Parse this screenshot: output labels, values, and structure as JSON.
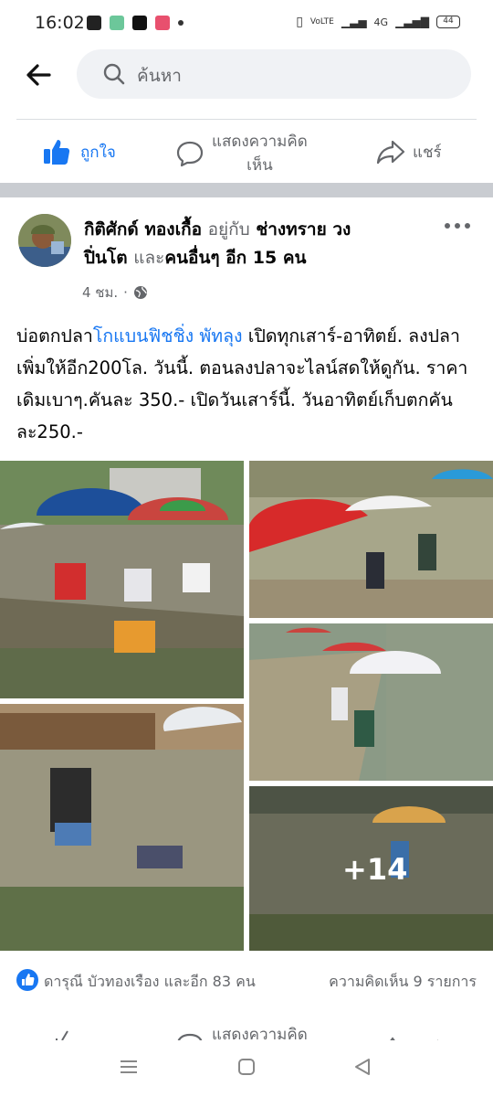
{
  "status": {
    "time": "16:02",
    "battery": "44",
    "net_labels": "VoLTE",
    "signal": "4G"
  },
  "search": {
    "placeholder": "ค้นหา"
  },
  "actions": {
    "like": "ถูกใจ",
    "comment_line1": "แสดงความคิด",
    "comment_line2": "เห็น",
    "share": "แชร์"
  },
  "post": {
    "author": "กิติศักด์ ทองเกื้อ",
    "with_word": "อยู่กับ",
    "tagged": "ช่างทราย วง",
    "tagged2": "ปิ่นโต",
    "and_word": "และ",
    "others": "คนอื่นๆ อีก 15 คน",
    "time": "4 ชม.",
    "text_pre": "บ่อตกปลา",
    "text_link": "โกแบนฟิชชิ่ง พัทลุง",
    "text_post": " เปิดทุกเสาร์-อาทิตย์. ลงปลาเพิ่มให้อีก200โล. วันนี้. ตอนลงปลาจะไลน์สดให้ดูกัน.  ราคาเดิมเบาๆ.คันละ 350.-  เปิดวันเสาร์นี้.  วันอาทิตย์เก็บตกคันละ250.-",
    "more_photos": "+14"
  },
  "reactions": {
    "names": "ดารุณี บัวทองเรือง และอีก 83 คน",
    "comments": "ความคิดเห็น 9 รายการ"
  },
  "colors": {
    "accent": "#1877f2",
    "muted": "#65676b",
    "band": "#c9ccd1"
  }
}
